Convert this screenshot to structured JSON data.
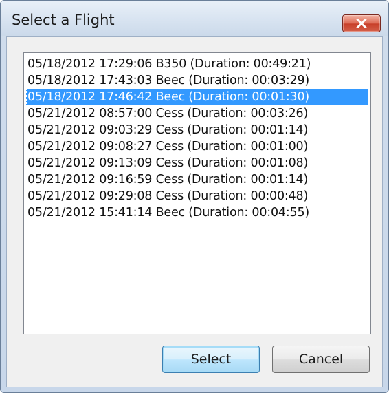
{
  "window": {
    "title": "Select a Flight"
  },
  "flights": [
    "05/18/2012 17:29:06  B350 (Duration: 00:49:21)",
    "05/18/2012 17:43:03  Beec (Duration: 00:03:29)",
    "05/18/2012 17:46:42  Beec (Duration: 00:01:30)",
    "05/21/2012 08:57:00  Cess (Duration: 00:03:26)",
    "05/21/2012 09:03:29  Cess (Duration: 00:01:14)",
    "05/21/2012 09:08:27  Cess (Duration: 00:01:00)",
    "05/21/2012 09:13:09  Cess (Duration: 00:01:08)",
    "05/21/2012 09:16:59  Cess (Duration: 00:01:14)",
    "05/21/2012 09:29:08  Cess (Duration: 00:00:48)",
    "05/21/2012 15:41:14  Beec (Duration: 00:04:55)"
  ],
  "selected_index": 2,
  "buttons": {
    "select_label": "Select",
    "cancel_label": "Cancel"
  },
  "colors": {
    "selection": "#3399ff",
    "close_button": "#c8402a"
  },
  "icons": {
    "close": "close-icon"
  }
}
